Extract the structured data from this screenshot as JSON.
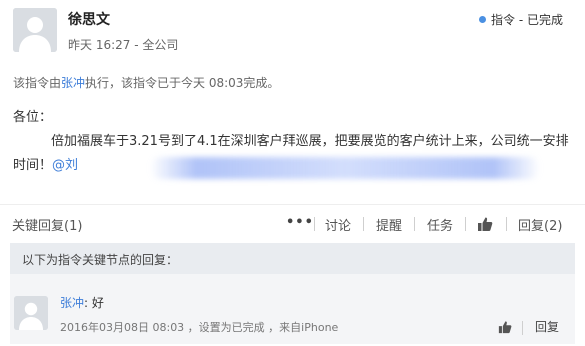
{
  "post": {
    "author": "徐思文",
    "time": "昨天 16:27",
    "scope": "全公司",
    "status_label": "指令 - 已完成",
    "status_color": "#4a90e2",
    "exec_prefix": "该指令由",
    "exec_user": "张冲",
    "exec_suffix": "执行，该指令已于今天 08:03完成。",
    "greeting": "各位：",
    "body": "倍加福展车于3.21号到了4.1在深圳客户拜巡展，把要展览的客户统计上来，公司统一安排时间！",
    "mention": "@刘"
  },
  "toolbar": {
    "key_replies": "关键回复(1)",
    "more_icon": "ellipsis-icon",
    "discuss": "讨论",
    "remind": "提醒",
    "task": "任务",
    "like_icon": "thumbs-up-icon",
    "reply": "回复(2)"
  },
  "panel": {
    "header": "以下为指令关键节点的回复："
  },
  "reply": {
    "user": "张冲",
    "text": ": 好",
    "meta": "2016年03月08日  08:03 ，设置为已完成 ，来自iPhone",
    "reply_label": "回复",
    "like_icon": "thumbs-up-icon"
  }
}
